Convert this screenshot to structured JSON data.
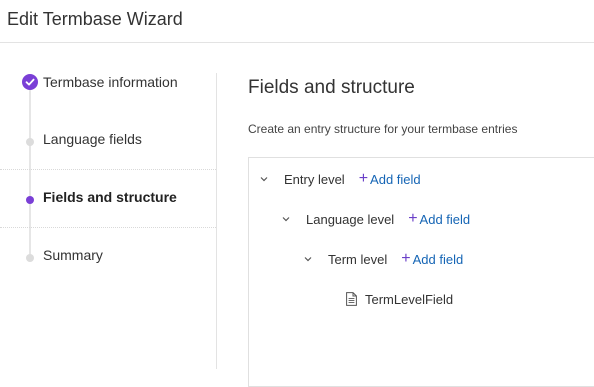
{
  "header": {
    "title": "Edit Termbase Wizard"
  },
  "steps": [
    {
      "label": "Termbase information",
      "state": "completed"
    },
    {
      "label": "Language fields",
      "state": "pending"
    },
    {
      "label": "Fields and structure",
      "state": "current"
    },
    {
      "label": "Summary",
      "state": "pending"
    }
  ],
  "main": {
    "title": "Fields and structure",
    "description": "Create an entry structure for your termbase entries",
    "tree": {
      "entry_level": {
        "label": "Entry level",
        "add_label": "Add field"
      },
      "language_level": {
        "label": "Language level",
        "add_label": "Add field"
      },
      "term_level": {
        "label": "Term level",
        "add_label": "Add field"
      },
      "term_field": {
        "label": "TermLevelField",
        "icon": "document-icon"
      }
    }
  },
  "colors": {
    "accent": "#7a3fd6",
    "link": "#1565b5"
  }
}
